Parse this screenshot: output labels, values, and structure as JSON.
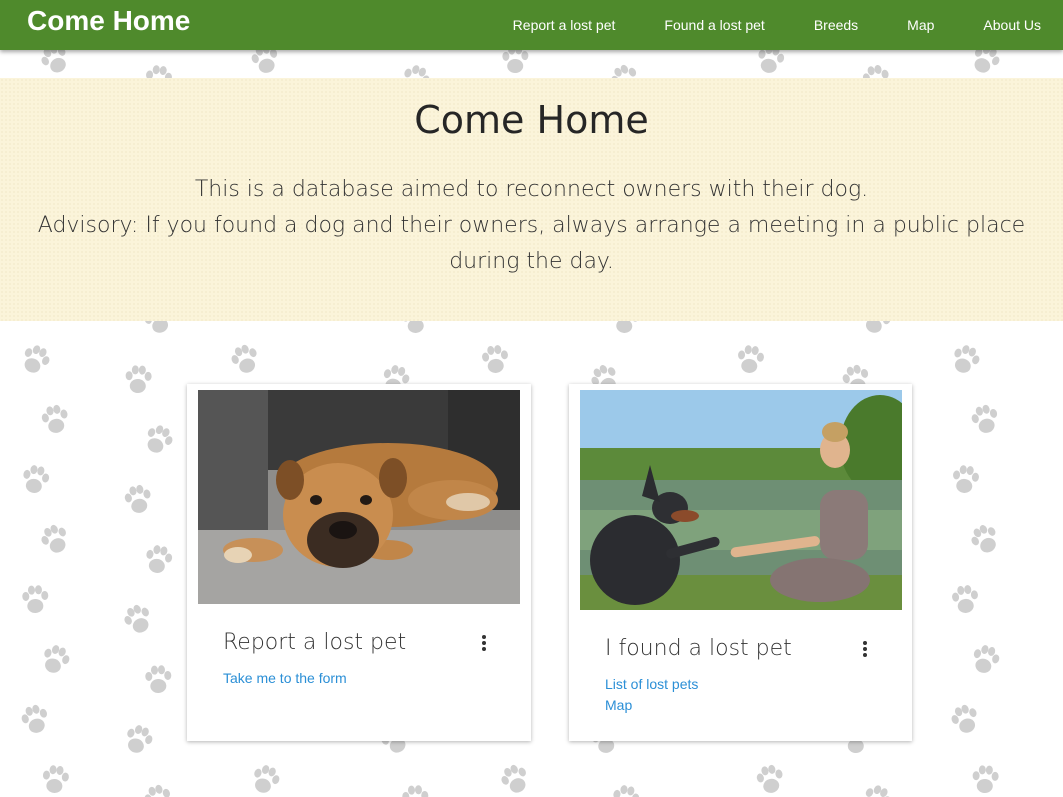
{
  "navbar": {
    "brand": "Come Home",
    "links": [
      "Report a lost pet",
      "Found a lost pet",
      "Breeds",
      "Map",
      "About Us"
    ],
    "color": "#4f8a2c"
  },
  "hero": {
    "title": "Come Home",
    "line1": "This is a database aimed to reconnect owners with their dog.",
    "line2": "Advisory: If you found a dog and their owners, always arrange a meeting in a public place during the day.",
    "background": "#fbf4da"
  },
  "cards": [
    {
      "image": "bulldog-lying-photo",
      "title": "Report a lost pet",
      "menu_icon": "more-vertical-icon",
      "links": [
        "Take me to the form"
      ]
    },
    {
      "image": "woman-doberman-handshake-photo",
      "title": "I found a lost pet",
      "menu_icon": "more-vertical-icon",
      "links": [
        "List of lost pets",
        "Map"
      ]
    }
  ],
  "colors": {
    "link": "#2b8fd6",
    "paw": "#cfcfcf"
  }
}
